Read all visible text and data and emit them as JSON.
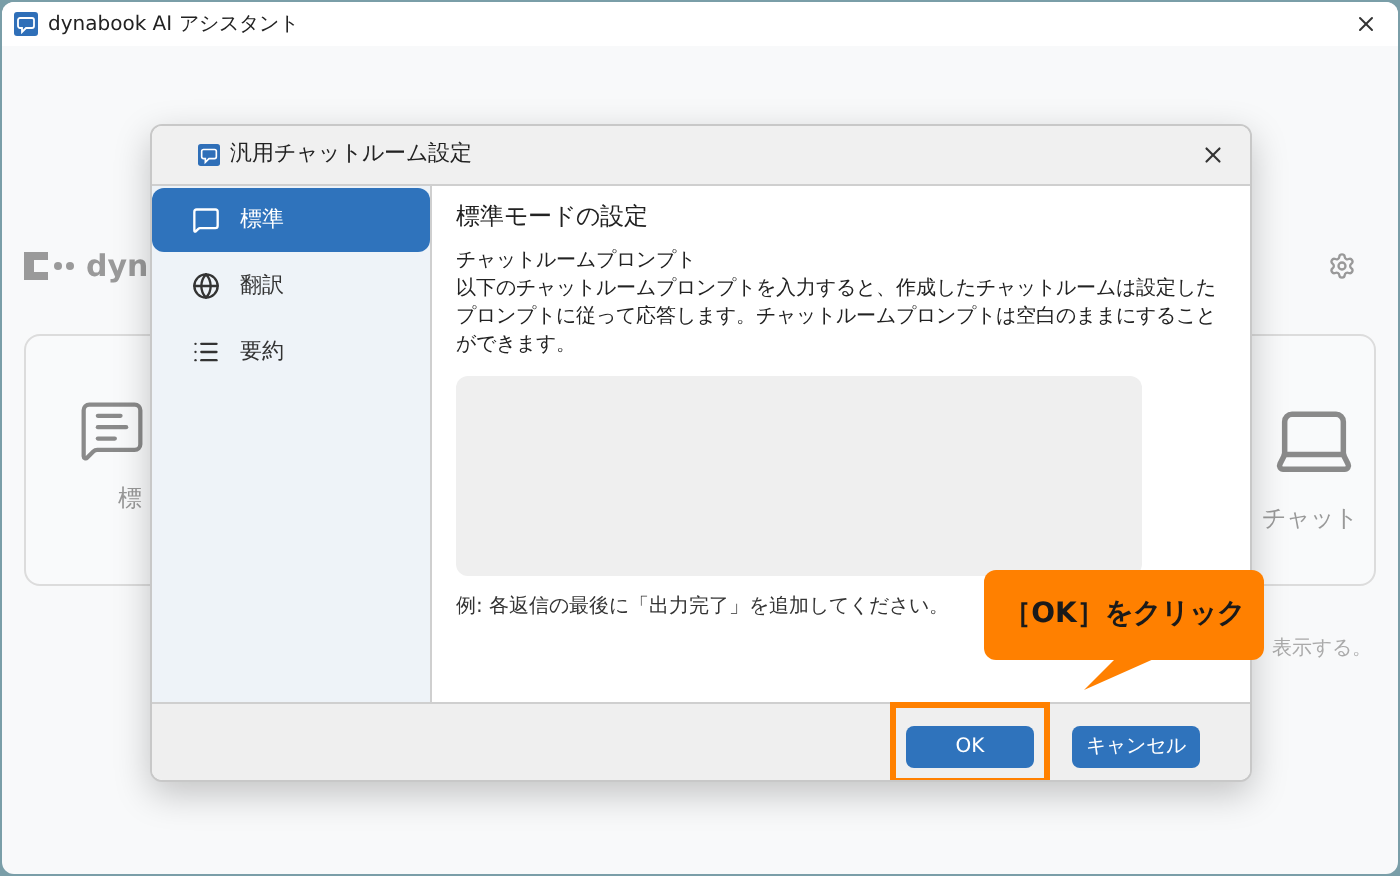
{
  "window": {
    "title": "dynabook AI アシスタント"
  },
  "background": {
    "logo": "dyn",
    "cards": [
      {
        "kind": "chat",
        "label": "標"
      },
      {
        "kind": "laptop",
        "label": "チャット"
      }
    ],
    "hint": "表示する。"
  },
  "dialog": {
    "title": "汎用チャットルーム設定",
    "sidebar": {
      "items": [
        {
          "kind": "chat",
          "label": "標準",
          "selected": true
        },
        {
          "kind": "globe",
          "label": "翻訳",
          "selected": false
        },
        {
          "kind": "list",
          "label": "要約",
          "selected": false
        }
      ]
    },
    "content": {
      "heading": "標準モードの設定",
      "prompt_label": "チャットルームプロンプト",
      "description": "以下のチャットルームプロンプトを入力すると、作成したチャットルームは設定したプロンプトに従って応答します。チャットルームプロンプトは空白のままにすることができます。",
      "example": "例: 各返信の最後に「出力完了」を追加してください。"
    },
    "buttons": [
      {
        "label": "OK",
        "highlighted": true
      },
      {
        "label": "キャンセル",
        "highlighted": false
      }
    ]
  },
  "callout": {
    "text": "［OK］をクリック"
  }
}
